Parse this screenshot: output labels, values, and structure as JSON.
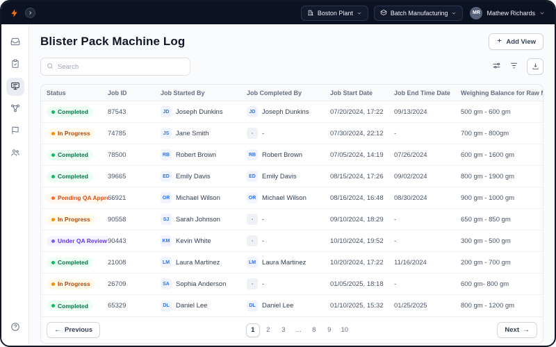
{
  "topbar": {
    "plant": "Boston Plant",
    "module": "Batch Manufacturing",
    "user_initials": "MR",
    "user_name": "Mathew Richards"
  },
  "page": {
    "title": "Blister Pack Machine Log",
    "add_view_label": "Add View"
  },
  "search": {
    "placeholder": "Search"
  },
  "table": {
    "columns": [
      "Status",
      "Job ID",
      "Job Started By",
      "Job Completed By",
      "Job Start Date",
      "Job End Time Date",
      "Weighing Balance for Raw Material"
    ],
    "rows": [
      {
        "status": "Completed",
        "status_type": "completed",
        "job_id": "87543",
        "started_initials": "JD",
        "started_name": "Joseph Dunkins",
        "completed_initials": "JD",
        "completed_name": "Joseph Dunkins",
        "start_date": "07/20/2024, 17:22",
        "end_date": "09/13/2024",
        "weighing": "500 gm - 600 gm"
      },
      {
        "status": "In Progress",
        "status_type": "in-progress",
        "job_id": "74785",
        "started_initials": "JS",
        "started_name": "Jane Smith",
        "completed_initials": "-",
        "completed_name": "-",
        "start_date": "07/30/2024, 22:12",
        "end_date": "-",
        "weighing": "700 gm -  800gm"
      },
      {
        "status": "Completed",
        "status_type": "completed",
        "job_id": "78500",
        "started_initials": "RB",
        "started_name": "Robert Brown",
        "completed_initials": "RB",
        "completed_name": "Robert Brown",
        "start_date": "07/05/2024, 14:19",
        "end_date": "07/26/2024",
        "weighing": "600 gm - 1600 gm"
      },
      {
        "status": "Completed",
        "status_type": "completed",
        "job_id": "39665",
        "started_initials": "ED",
        "started_name": "Emily Davis",
        "completed_initials": "ED",
        "completed_name": "Emily Davis",
        "start_date": "08/15/2024, 17:26",
        "end_date": "09/02/2024",
        "weighing": "800 gm - 1900 gm"
      },
      {
        "status": "Pending QA Approval",
        "status_type": "pending",
        "job_id": "66921",
        "started_initials": "OR",
        "started_name": "Michael Wilson",
        "completed_initials": "OR",
        "completed_name": "Michael Wilson",
        "start_date": "08/16/2024, 16:48",
        "end_date": "08/30/2024",
        "weighing": "900 gm - 1000 gm"
      },
      {
        "status": "In Progress",
        "status_type": "in-progress",
        "job_id": "90558",
        "started_initials": "SJ",
        "started_name": "Sarah Johnson",
        "completed_initials": "-",
        "completed_name": "-",
        "start_date": "09/10/2024, 18:29",
        "end_date": "-",
        "weighing": "650 gm - 850 gm"
      },
      {
        "status": "Under QA Review",
        "status_type": "review",
        "job_id": "90443",
        "started_initials": "KM",
        "started_name": "Kevin White",
        "completed_initials": "-",
        "completed_name": "-",
        "start_date": "10/10/2024, 19:52",
        "end_date": "-",
        "weighing": "300 gm - 500 gm"
      },
      {
        "status": "Completed",
        "status_type": "completed",
        "job_id": "21008",
        "started_initials": "LM",
        "started_name": "Laura Martinez",
        "completed_initials": "LM",
        "completed_name": "Laura Martinez",
        "start_date": "10/20/2024, 17:22",
        "end_date": "11/16/2024",
        "weighing": "200 gm - 700 gm"
      },
      {
        "status": "In Progress",
        "status_type": "in-progress",
        "job_id": "26709",
        "started_initials": "SA",
        "started_name": "Sophia Anderson",
        "completed_initials": "-",
        "completed_name": "-",
        "start_date": "01/05/2025, 18:18",
        "end_date": "-",
        "weighing": "600 gm- 800 gm"
      },
      {
        "status": "Completed",
        "status_type": "completed",
        "job_id": "65329",
        "started_initials": "DL",
        "started_name": "Daniel Lee",
        "completed_initials": "DL",
        "completed_name": "Daniel Lee",
        "start_date": "01/10/2025, 15:32",
        "end_date": "01/25/2025",
        "weighing": "800 gm - 1200 gm"
      }
    ]
  },
  "pagination": {
    "previous_label": "Previous",
    "next_label": "Next",
    "pages": [
      "1",
      "2",
      "3",
      "...",
      "8",
      "9",
      "10"
    ],
    "active_page": "1"
  },
  "colors": {
    "topbar_bg": "#0c1222",
    "logo_orange": "#f97316",
    "accent_blue": "#2970ff",
    "status_completed": "#067647",
    "status_in_progress": "#b54708",
    "status_pending_qa": "#e04f16",
    "status_under_review": "#6938ef"
  }
}
